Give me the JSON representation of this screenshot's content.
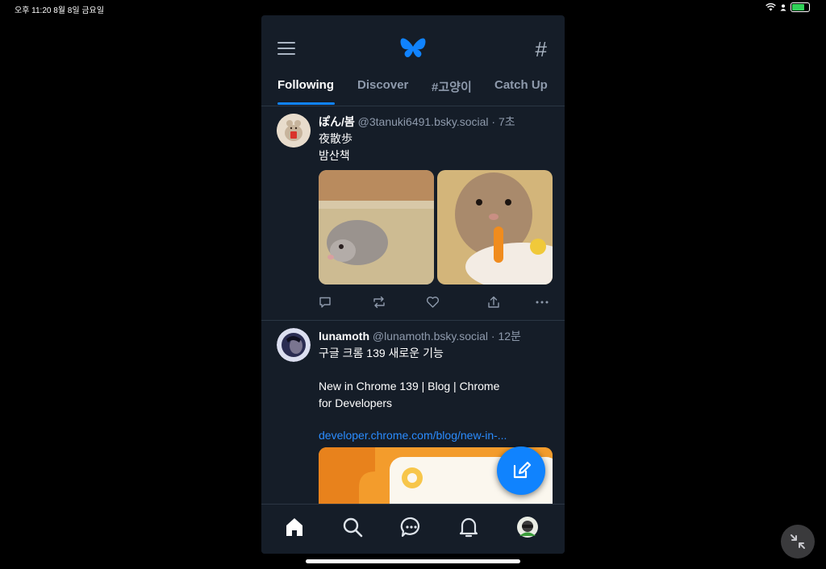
{
  "status_bar": {
    "datetime": "오후 11:20   8월 8일 금요일",
    "battery_level": 0.85,
    "battery_color": "#30d158"
  },
  "header": {
    "menu_icon": "hamburger-menu-icon",
    "logo_icon": "butterfly-logo",
    "feeds_icon": "hash-icon",
    "hash_symbol": "#",
    "brand_color": "#1083fe"
  },
  "tabs": [
    {
      "label": "Following",
      "active": true
    },
    {
      "label": "Discover",
      "active": false
    },
    {
      "label": "#고양이",
      "active": false
    },
    {
      "label": "Catch Up",
      "active": false
    }
  ],
  "posts": [
    {
      "display_name": "ぽん/봄",
      "handle": "@3tanuki6491.bsky.social",
      "time": "· 7초",
      "text_lines": [
        "夜散歩",
        "밤산책"
      ],
      "images": [
        "hamster-on-mat-photo",
        "hamster-eating-photo"
      ],
      "actions": [
        "reply-icon",
        "repost-icon",
        "like-icon",
        "share-icon",
        "more-icon"
      ]
    },
    {
      "display_name": "lunamoth",
      "handle": "@lunamoth.bsky.social",
      "time": "· 12분",
      "text_line1": "구글 크롬 139 새로운 기능",
      "text_line2": "New in Chrome 139 | Blog | Chrome",
      "text_line3": "for Developers",
      "link": "developer.chrome.com/blog/new-in-..."
    }
  ],
  "compose_button_icon": "compose-pencil-icon",
  "bottom_nav": [
    "home-icon",
    "search-icon",
    "chat-icon",
    "notifications-bell-icon",
    "profile-avatar"
  ],
  "colors": {
    "background": "#151d28",
    "divider": "#2b3644",
    "muted_text": "#8e9aac",
    "accent": "#1083fe",
    "link": "#2b8cff"
  }
}
